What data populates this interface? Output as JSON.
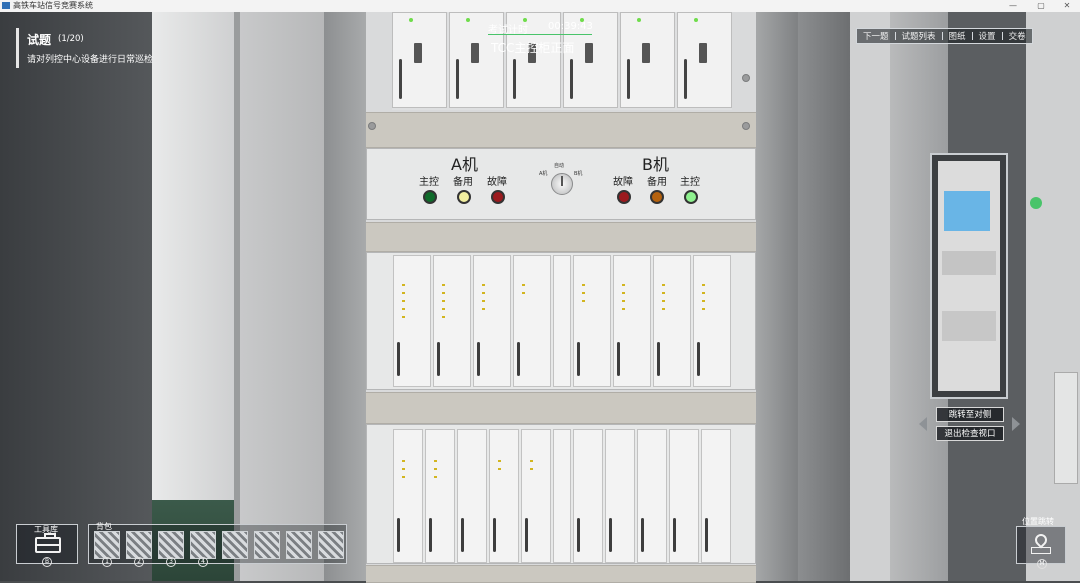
{
  "window": {
    "title": "高铁车站信号竞赛系统",
    "controls": [
      "—",
      "▢",
      "✕"
    ]
  },
  "question": {
    "title": "试题",
    "counter": "(1/20)",
    "text": "请对列控中心设备进行日常巡检"
  },
  "timer": {
    "label": "考试计时",
    "value": "00:39:43",
    "location": "TCC主控柜正面"
  },
  "topnav": {
    "items": [
      "下一题",
      "试题列表",
      "图纸",
      "设置",
      "交卷"
    ]
  },
  "cabinet": {
    "a_title": "A机",
    "b_title": "B机",
    "a_lamps": [
      {
        "label": "主控",
        "color": "#0f6b2a"
      },
      {
        "label": "备用",
        "color": "#f2efa0"
      },
      {
        "label": "故障",
        "color": "#9b1a1e"
      }
    ],
    "b_lamps": [
      {
        "label": "故障",
        "color": "#9b1a1e"
      },
      {
        "label": "备用",
        "color": "#b5620e"
      },
      {
        "label": "主控",
        "color": "#8ff28f"
      }
    ],
    "knob": {
      "top_label": "自动",
      "left_label": "A机",
      "right_label": "B机"
    }
  },
  "minimap": {
    "jump_label": "跳转至对侧",
    "exit_label": "退出检查视口"
  },
  "toolbox": {
    "label": "工具库",
    "hotkey": "B"
  },
  "backpack": {
    "label": "背包",
    "slot_numbers": [
      "1",
      "2",
      "3",
      "4"
    ]
  },
  "position_jump": {
    "label": "位置跳转",
    "hotkey": "M"
  },
  "colors": {
    "accent_green": "#49c46a",
    "hud_border": "#d4d8dc"
  }
}
